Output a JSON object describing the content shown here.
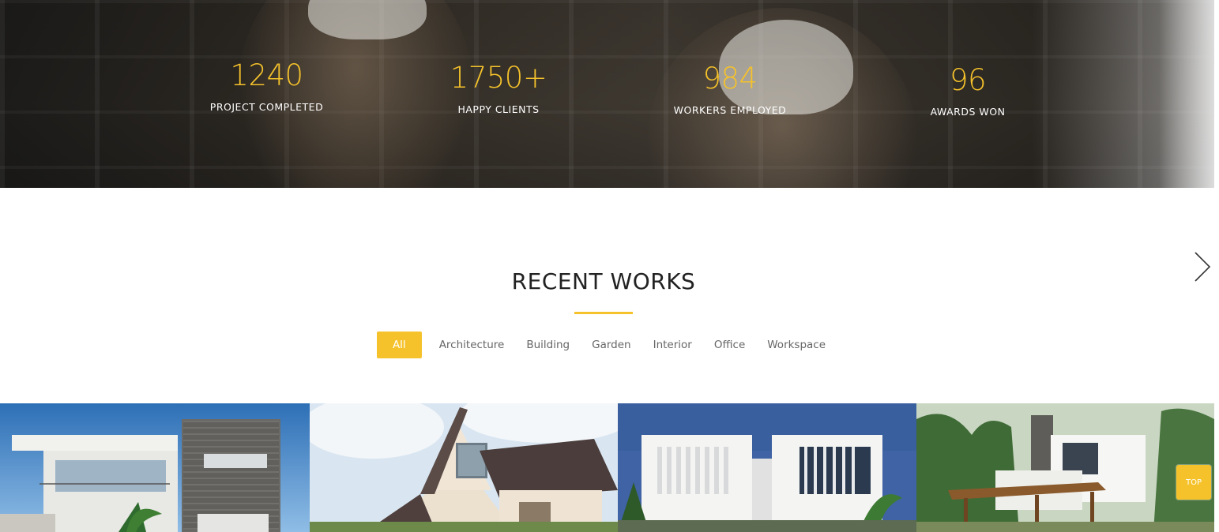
{
  "stats": [
    {
      "number": "1240",
      "label": "PROJECT COMPLETED"
    },
    {
      "number": "1750+",
      "label": "HAPPY CLIENTS"
    },
    {
      "number": "984",
      "label": "WORKERS EMPLOYED"
    },
    {
      "number": "96",
      "label": "AWARDS WON"
    }
  ],
  "recent_works": {
    "title": "RECENT WORKS",
    "filters": [
      "All",
      "Architecture",
      "Building",
      "Garden",
      "Interior",
      "Office",
      "Workspace"
    ],
    "active_filter": "All"
  },
  "carousel": {
    "next_icon": "chevron-right-icon"
  },
  "back_to_top": {
    "label": "TOP"
  },
  "colors": {
    "accent": "#f5c22b",
    "title": "#222222",
    "filter_text": "#666666"
  }
}
